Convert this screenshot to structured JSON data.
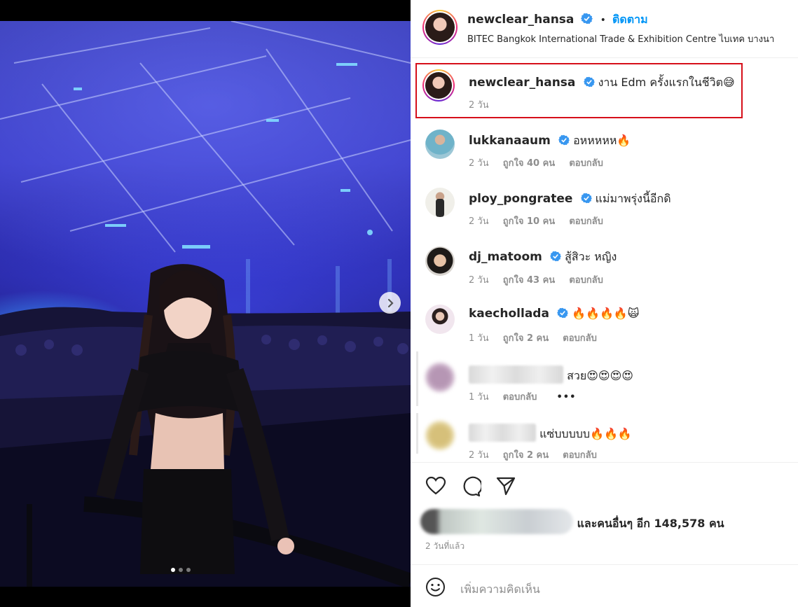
{
  "post": {
    "author": "newclear_hansa",
    "follow_separator": "•",
    "follow_label": "ติดตาม",
    "location": "BITEC Bangkok International Trade & Exhibition Centre ไบเทค บางนา",
    "caption": {
      "username": "newclear_hansa",
      "text": "งาน Edm ครั้งแรกในชีวิต😅",
      "time": "2 วัน"
    },
    "carousel": {
      "total_images": 3,
      "current_index": 1
    }
  },
  "comments": [
    {
      "username": "lukkanaaum",
      "text": "อหหหหห🔥",
      "time": "2 วัน",
      "likes": "ถูกใจ 40 คน",
      "reply": "ตอบกลับ",
      "verified": true
    },
    {
      "username": "ploy_pongratee",
      "text": "แม่มาพรุ่งนี้อีกดิ",
      "time": "2 วัน",
      "likes": "ถูกใจ 10 คน",
      "reply": "ตอบกลับ",
      "verified": true
    },
    {
      "username": "dj_matoom",
      "text": "สู้สิวะ หญิง",
      "time": "2 วัน",
      "likes": "ถูกใจ 43 คน",
      "reply": "ตอบกลับ",
      "verified": true
    },
    {
      "username": "kaechollada",
      "text": "🔥🔥🔥🔥🙀",
      "time": "1 วัน",
      "likes": "ถูกใจ 2 คน",
      "reply": "ตอบกลับ",
      "verified": true
    },
    {
      "username": "",
      "text": "สวย😍😍😍😍",
      "time": "1 วัน",
      "reply": "ตอบกลับ",
      "more": "•••",
      "verified": false
    },
    {
      "username": "",
      "text": "แซ่บบบบบ🔥🔥🔥",
      "time": "2 วัน",
      "likes": "ถูกใจ 2 คน",
      "reply": "ตอบกลับ",
      "verified": false
    }
  ],
  "likes_summary": {
    "text": "และคนอื่นๆ อีก 148,578 คน",
    "count": 148578
  },
  "posted_ago": "2 วันที่แล้ว",
  "add_comment": {
    "placeholder": "เพิ่มความคิดเห็น"
  },
  "icons": {
    "like": "heart-icon",
    "comment": "comment-icon",
    "share": "share-icon",
    "emoji": "smiley-icon",
    "next": "chevron-right-icon",
    "verified": "verified-badge-icon"
  },
  "colors": {
    "follow": "#0095f6",
    "verified": "#3897f0",
    "highlight": "#d60f1a"
  }
}
